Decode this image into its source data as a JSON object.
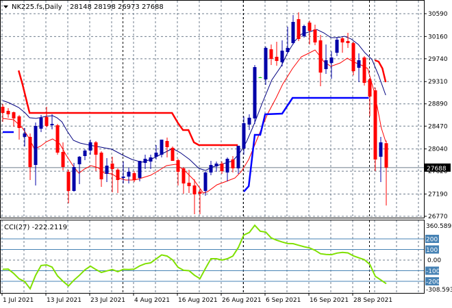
{
  "header": {
    "symbol": "NK225.fs,Daily",
    "ohlc": "28148 28198 26973 27688"
  },
  "price_axis": [
    "30590",
    "30160",
    "29740",
    "29310",
    "28890",
    "28470",
    "28040",
    "27620",
    "27190",
    "26770"
  ],
  "current_price_label": "27688",
  "cci_panel": {
    "title": "CCI(27) -222.2119",
    "max_label": "360.5895",
    "min_label": "-308.593",
    "zero_label": "0.00",
    "levels": [
      "200",
      "100",
      "-100",
      "-200"
    ]
  },
  "dates": [
    {
      "label": "1 Jul 2021",
      "bar": 0
    },
    {
      "label": "13 Jul 2021",
      "bar": 8
    },
    {
      "label": "23 Jul 2021",
      "bar": 16
    },
    {
      "label": "4 Aug 2021",
      "bar": 24
    },
    {
      "label": "16 Aug 2021",
      "bar": 32
    },
    {
      "label": "26 Aug 2021",
      "bar": 40
    },
    {
      "label": "6 Sep 2021",
      "bar": 48
    },
    {
      "label": "16 Sep 2021",
      "bar": 56
    },
    {
      "label": "28 Sep 2021",
      "bar": 64
    }
  ],
  "colors": {
    "bull": "#0000a8",
    "bear": "#ff0000",
    "doji": "#00c800",
    "ma_fast": "#000080",
    "ma_slow": "#ff0000",
    "stop_high": "#ff0000",
    "stop_low": "#0000ff",
    "cci": "#7fe000",
    "level": "#4682b4",
    "grid": "#6c7b8b"
  },
  "chart_data": {
    "type": "candlestick",
    "title": "NK225.fs,Daily",
    "ylim": [
      26770,
      30590
    ],
    "period_separators_bar": [
      22,
      44,
      67
    ],
    "ohlc": [
      [
        28835,
        28886,
        28551,
        28719
      ],
      [
        28757,
        28809,
        28628,
        28693
      ],
      [
        28732,
        28745,
        28461,
        28615
      ],
      [
        28654,
        28680,
        28215,
        28435
      ],
      [
        28267,
        28435,
        28086,
        28332
      ],
      [
        28267,
        28332,
        27454,
        27699
      ],
      [
        27738,
        28538,
        27351,
        28473
      ],
      [
        28422,
        28680,
        28357,
        28628
      ],
      [
        28641,
        28835,
        28448,
        28473
      ],
      [
        28486,
        28693,
        28409,
        28512
      ],
      [
        28486,
        28512,
        27931,
        27970
      ],
      [
        27983,
        28164,
        27635,
        27699
      ],
      [
        27609,
        27648,
        27015,
        27248
      ],
      [
        27248,
        27777,
        27235,
        27699
      ],
      [
        27751,
        27906,
        27377,
        27893
      ],
      [
        27906,
        28035,
        27828,
        28009
      ],
      [
        28009,
        28215,
        27931,
        28164
      ],
      [
        28164,
        28190,
        27622,
        27931
      ],
      [
        27970,
        27996,
        27325,
        27467
      ],
      [
        27570,
        27867,
        27415,
        27725
      ],
      [
        27764,
        27893,
        27222,
        27661
      ],
      [
        27648,
        27674,
        27209,
        27454
      ],
      [
        27493,
        27802,
        27389,
        27519
      ],
      [
        27519,
        27686,
        27389,
        27609
      ],
      [
        27583,
        27622,
        27415,
        27454
      ],
      [
        27493,
        27815,
        27428,
        27815
      ],
      [
        27777,
        27931,
        27661,
        27854
      ],
      [
        27802,
        27931,
        27661,
        27880
      ],
      [
        27893,
        28112,
        27841,
        27970
      ],
      [
        27931,
        28215,
        27880,
        28215
      ],
      [
        28190,
        28254,
        27880,
        28073
      ],
      [
        28061,
        28087,
        27815,
        27815
      ],
      [
        27828,
        27854,
        27351,
        27609
      ],
      [
        27674,
        27699,
        27196,
        27389
      ],
      [
        27403,
        27648,
        27209,
        27338
      ],
      [
        27351,
        27467,
        26809,
        27183
      ],
      [
        27235,
        27286,
        26809,
        27196
      ],
      [
        27248,
        27620,
        27157,
        27596
      ],
      [
        27596,
        27815,
        27544,
        27738
      ],
      [
        27712,
        27802,
        27609,
        27764
      ],
      [
        27764,
        27802,
        27570,
        27622
      ],
      [
        27596,
        27880,
        27428,
        27854
      ],
      [
        27841,
        27906,
        27596,
        27674
      ],
      [
        27674,
        28100,
        27570,
        28100
      ],
      [
        28048,
        28654,
        27931,
        28525
      ],
      [
        28499,
        28693,
        28396,
        28628
      ],
      [
        28615,
        29622,
        28512,
        29583
      ],
      [
        29390,
        29400,
        29380,
        29390
      ],
      [
        29351,
        29970,
        29248,
        29945
      ],
      [
        29919,
        30009,
        29622,
        29738
      ],
      [
        29777,
        30061,
        29609,
        29699
      ],
      [
        29674,
        30087,
        29596,
        29893
      ],
      [
        29867,
        30345,
        29841,
        29945
      ],
      [
        30035,
        30564,
        30009,
        30435
      ],
      [
        30487,
        30616,
        30074,
        30112
      ],
      [
        30164,
        30383,
        30138,
        30358
      ],
      [
        30422,
        30461,
        30009,
        30267
      ],
      [
        30293,
        30383,
        29996,
        30048
      ],
      [
        30087,
        30190,
        29222,
        29480
      ],
      [
        29545,
        30009,
        29454,
        29712
      ],
      [
        29661,
        29880,
        29364,
        29764
      ],
      [
        29854,
        30151,
        29790,
        30100
      ],
      [
        30125,
        30151,
        29854,
        30048
      ],
      [
        30074,
        30229,
        29945,
        30035
      ],
      [
        30035,
        30061,
        29428,
        29506
      ],
      [
        29570,
        29841,
        29299,
        29712
      ],
      [
        29764,
        29790,
        29235,
        29286
      ],
      [
        29351,
        29377,
        28654,
        29028
      ],
      [
        29145,
        29196,
        27622,
        27841
      ],
      [
        27893,
        28267,
        27415,
        28164
      ],
      [
        28148,
        28198,
        26973,
        27688
      ]
    ],
    "ma_fast": [
      [
        0,
        28951
      ],
      [
        1.1,
        28912
      ],
      [
        2.9,
        28822
      ],
      [
        4.1,
        28719
      ],
      [
        4.9,
        28628
      ],
      [
        6.1,
        28615
      ],
      [
        7.9,
        28654
      ],
      [
        9.1,
        28667
      ],
      [
        9.9,
        28628
      ],
      [
        10.8,
        28551
      ],
      [
        11.8,
        28370
      ],
      [
        12.9,
        28203
      ],
      [
        14.1,
        28151
      ],
      [
        15.8,
        28112
      ],
      [
        17.9,
        28073
      ],
      [
        19.9,
        28035
      ],
      [
        22,
        27919
      ],
      [
        23.6,
        27841
      ],
      [
        25.4,
        27790
      ],
      [
        27,
        27841
      ],
      [
        31,
        28048
      ],
      [
        32.4,
        27970
      ],
      [
        34.1,
        27841
      ],
      [
        35.8,
        27673
      ],
      [
        37,
        27635
      ],
      [
        38.3,
        27699
      ],
      [
        39.9,
        27751
      ],
      [
        42,
        27815
      ],
      [
        43.3,
        27970
      ],
      [
        44.5,
        28177
      ],
      [
        45.8,
        28486
      ],
      [
        47.4,
        28912
      ],
      [
        49.1,
        29338
      ],
      [
        50.8,
        29596
      ],
      [
        52,
        29854
      ],
      [
        53.3,
        30074
      ],
      [
        54.5,
        30203
      ],
      [
        55.8,
        30241
      ],
      [
        57.3,
        30293
      ],
      [
        58.6,
        30229
      ],
      [
        59.9,
        30138
      ],
      [
        61.1,
        30138
      ],
      [
        62.4,
        30164
      ],
      [
        63.6,
        30112
      ],
      [
        64.9,
        30009
      ],
      [
        66.1,
        29854
      ],
      [
        67.4,
        29725
      ],
      [
        68.6,
        29428
      ],
      [
        69.9,
        29054
      ]
    ],
    "ma_slow": [
      [
        0,
        28615
      ],
      [
        2,
        28590
      ],
      [
        3.6,
        28435
      ],
      [
        4.9,
        28228
      ],
      [
        5.8,
        28035
      ],
      [
        7,
        28099
      ],
      [
        8,
        28177
      ],
      [
        9.1,
        28228
      ],
      [
        10.4,
        28138
      ],
      [
        11.6,
        27919
      ],
      [
        12.9,
        27712
      ],
      [
        13.9,
        27583
      ],
      [
        14.9,
        27661
      ],
      [
        16.1,
        27725
      ],
      [
        17.4,
        27686
      ],
      [
        18.6,
        27583
      ],
      [
        19.9,
        27570
      ],
      [
        21.1,
        27493
      ],
      [
        22.4,
        27454
      ],
      [
        24.1,
        27454
      ],
      [
        25.4,
        27493
      ],
      [
        27,
        27544
      ],
      [
        28.3,
        27622
      ],
      [
        29.9,
        27725
      ],
      [
        31.6,
        27751
      ],
      [
        33.3,
        27622
      ],
      [
        34.9,
        27454
      ],
      [
        36.6,
        27209
      ],
      [
        37.4,
        27235
      ],
      [
        39.1,
        27364
      ],
      [
        40.8,
        27428
      ],
      [
        42.4,
        27493
      ],
      [
        43.6,
        27622
      ],
      [
        44.9,
        27841
      ],
      [
        46.6,
        28267
      ],
      [
        48.3,
        28693
      ],
      [
        49.9,
        29003
      ],
      [
        51.1,
        29261
      ],
      [
        52.9,
        29558
      ],
      [
        54.5,
        29777
      ],
      [
        55.8,
        29841
      ],
      [
        57,
        29906
      ],
      [
        57.9,
        29790
      ],
      [
        58.6,
        29687
      ],
      [
        59.9,
        29596
      ],
      [
        61.6,
        29661
      ],
      [
        62.9,
        29751
      ],
      [
        63.9,
        29687
      ],
      [
        65.4,
        29622
      ],
      [
        66.6,
        29558
      ],
      [
        67.9,
        29080
      ],
      [
        69.1,
        28435
      ],
      [
        69.9,
        28177
      ]
    ],
    "stop_high": [
      [
        [
          2.9,
          29519
        ],
        [
          3.6,
          29261
        ],
        [
          4.9,
          28719
        ],
        [
          30.9,
          28719
        ],
        [
          32,
          28525
        ],
        [
          32.9,
          28396
        ],
        [
          33.9,
          28396
        ],
        [
          34.9,
          28164
        ],
        [
          35.8,
          28112
        ],
        [
          42.9,
          28112
        ]
      ],
      [
        [
          67.9,
          29712
        ],
        [
          68.6,
          29687
        ],
        [
          69.3,
          29558
        ],
        [
          69.9,
          29300
        ]
      ]
    ],
    "stop_low": [
      [
        [
          0,
          28357
        ],
        [
          2,
          28357
        ]
      ],
      [
        [
          44,
          27235
        ],
        [
          44.9,
          27338
        ],
        [
          46,
          28306
        ],
        [
          47,
          28306
        ],
        [
          47.9,
          28693
        ],
        [
          51,
          28706
        ],
        [
          52.9,
          29003
        ],
        [
          66.8,
          29003
        ]
      ]
    ],
    "cci": {
      "name": "CCI(27)",
      "ylim": [
        -308.5934,
        360.5895
      ],
      "levels": [
        200,
        100,
        -100,
        -200
      ],
      "values": [
        -87,
        -85,
        -126,
        -177,
        -202,
        -270,
        -143,
        -51,
        -45,
        -66,
        -149,
        -200,
        -243,
        -189,
        -143,
        -92,
        -57,
        -89,
        -117,
        -102,
        -89,
        -109,
        -87,
        -89,
        -85,
        -55,
        -34,
        -26,
        11,
        49,
        38,
        2,
        -68,
        -96,
        -100,
        -143,
        -175,
        -79,
        13,
        13,
        0,
        13,
        38,
        119,
        236,
        260,
        328,
        272,
        264,
        209,
        187,
        170,
        157,
        155,
        140,
        126,
        115,
        92,
        60,
        53,
        51,
        66,
        72,
        68,
        40,
        21,
        4,
        -40,
        -153,
        -187,
        -222
      ]
    }
  }
}
